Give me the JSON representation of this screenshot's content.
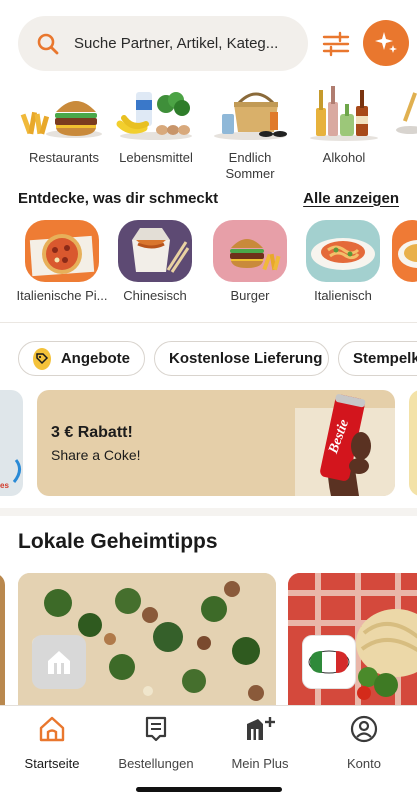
{
  "search": {
    "placeholder": "Suche Partner, Artikel, Kateg..."
  },
  "icons": {
    "search": "search-icon",
    "filter": "filter-sliders-icon",
    "assistant": "sparkle-icon"
  },
  "colors": {
    "accent": "#e9772e",
    "promo_bg": "#e5cfa9",
    "chip_tag": "#f4c23a"
  },
  "categories": [
    {
      "label": "Restaurants"
    },
    {
      "label": "Lebensmittel"
    },
    {
      "label": "Endlich Sommer"
    },
    {
      "label": "Alkohol"
    }
  ],
  "discover": {
    "title": "Entdecke, was dir schmeckt",
    "see_all": "Alle anzeigen"
  },
  "cuisines": [
    {
      "label": "Italienische Pi..."
    },
    {
      "label": "Chinesisch"
    },
    {
      "label": "Burger"
    },
    {
      "label": "Italienisch"
    }
  ],
  "chips": [
    {
      "label": "Angebote"
    },
    {
      "label": "Kostenlose Lieferung"
    },
    {
      "label": "Stempelk"
    }
  ],
  "promo": {
    "title": "3 € Rabatt!",
    "subtitle": "Share a Coke!",
    "can_text": "Bestie"
  },
  "local_tips": {
    "title": "Lokale Geheimtipps"
  },
  "bottom_nav": [
    {
      "label": "Startseite",
      "icon": "home-icon",
      "active": true
    },
    {
      "label": "Bestellungen",
      "icon": "receipt-icon",
      "active": false
    },
    {
      "label": "Mein Plus",
      "icon": "plus-membership-icon",
      "active": false
    },
    {
      "label": "Konto",
      "icon": "account-icon",
      "active": false
    }
  ]
}
